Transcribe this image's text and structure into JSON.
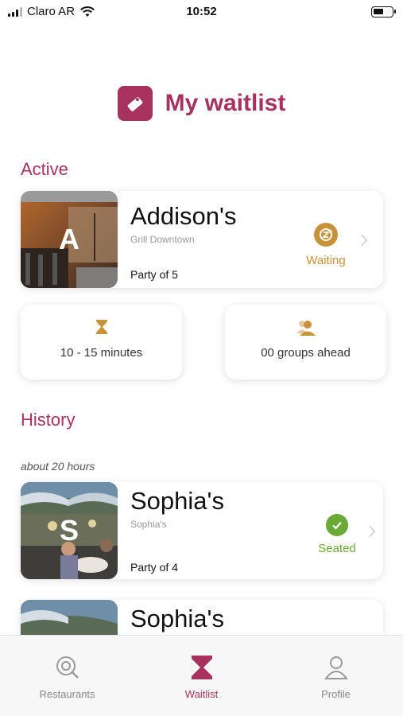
{
  "status_bar": {
    "carrier": "Claro AR",
    "time": "10:52",
    "signal_icon": "signal-icon",
    "wifi_icon": "wifi-icon",
    "battery_icon": "battery-icon",
    "battery_level": 0.55
  },
  "header": {
    "title": "My waitlist",
    "icon": "ticket-icon",
    "accent_color": "#a8325e"
  },
  "active": {
    "section_title": "Active",
    "card": {
      "initial": "A",
      "name": "Addison's",
      "subtitle": "Grill Downtown",
      "party": "Party of 5",
      "status": "Waiting",
      "status_icon": "clock-refresh-icon",
      "status_color": "#c9913a"
    },
    "wait_time": {
      "icon": "hourglass-icon",
      "text": "10 - 15 minutes"
    },
    "groups_ahead": {
      "icon": "people-icon",
      "text": "00 groups ahead"
    }
  },
  "history": {
    "section_title": "History",
    "time_label": "about 20 hours",
    "items": [
      {
        "initial": "S",
        "name": "Sophia's",
        "subtitle": "Sophia's",
        "party": "Party of 4",
        "status": "Seated",
        "status_icon": "checkmark-icon",
        "status_color": "#6aaa35"
      },
      {
        "name": "Sophia's"
      }
    ]
  },
  "tab_bar": {
    "tabs": [
      {
        "label": "Restaurants",
        "icon": "search-icon",
        "active": false
      },
      {
        "label": "Waitlist",
        "icon": "hourglass-icon",
        "active": true
      },
      {
        "label": "Profile",
        "icon": "user-icon",
        "active": false
      }
    ]
  }
}
